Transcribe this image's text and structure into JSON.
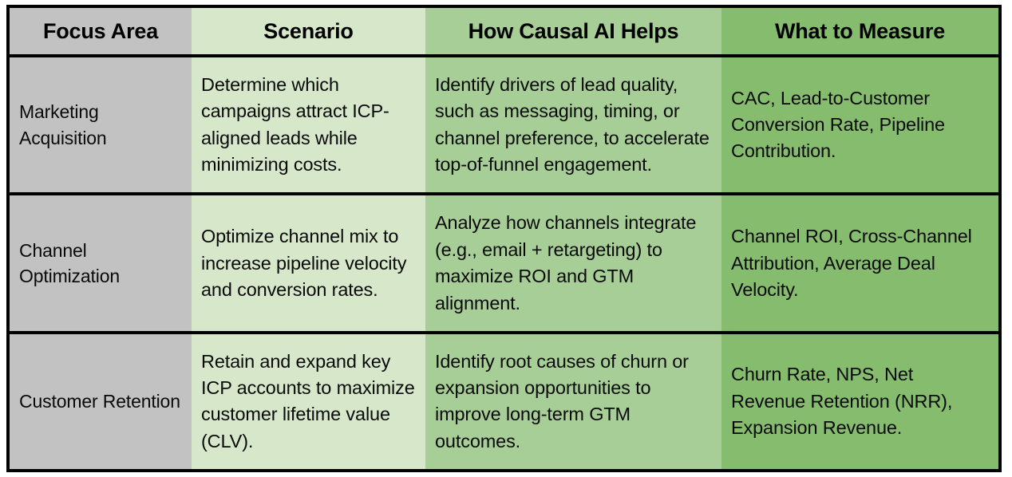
{
  "table": {
    "columns": [
      {
        "key": "focus_area",
        "label": "Focus Area",
        "color": "#c2c2c2"
      },
      {
        "key": "scenario",
        "label": "Scenario",
        "color": "#d6e8c9"
      },
      {
        "key": "how_causal_ai_helps",
        "label": "How Causal AI Helps",
        "color": "#a7ce96"
      },
      {
        "key": "what_to_measure",
        "label": "What to Measure",
        "color": "#85bc6e"
      }
    ],
    "rows": [
      {
        "focus_area": "Marketing Acquisition",
        "scenario": "Determine which campaigns attract ICP-aligned leads while minimizing costs.",
        "how_causal_ai_helps": "Identify drivers of lead quality, such as messaging, timing, or channel preference, to accelerate top-of-funnel engagement.",
        "what_to_measure": "CAC, Lead-to-Customer Conversion Rate, Pipeline Contribution."
      },
      {
        "focus_area": "Channel Optimization",
        "scenario": "Optimize channel mix to increase pipeline velocity and conversion rates.",
        "how_causal_ai_helps": "Analyze how channels integrate (e.g., email + retargeting) to maximize ROI and GTM alignment.",
        "what_to_measure": "Channel ROI, Cross-Channel Attribution, Average Deal Velocity."
      },
      {
        "focus_area": "Customer Retention",
        "scenario": "Retain and expand key ICP accounts to maximize customer lifetime value (CLV).",
        "how_causal_ai_helps": "Identify root causes of churn or expansion opportunities to improve long-term GTM outcomes.",
        "what_to_measure": "Churn Rate, NPS, Net Revenue Retention (NRR), Expansion Revenue."
      }
    ],
    "border_color": "#000000",
    "text_color": "#0a0a0a"
  }
}
